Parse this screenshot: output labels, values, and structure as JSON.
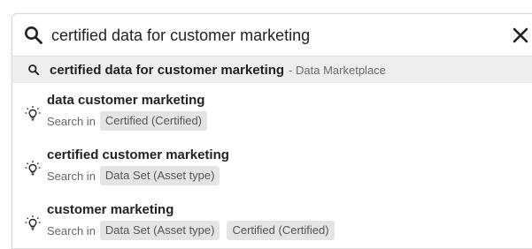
{
  "search": {
    "value": "certified data for customer marketing",
    "icon": "search-icon",
    "clear_icon": "close-icon"
  },
  "top_suggestion": {
    "icon": "search-icon",
    "query": "certified data for customer marketing",
    "source": "- Data Marketplace"
  },
  "results": [
    {
      "icon": "lightbulb-icon",
      "title": "data customer marketing",
      "search_in": "Search in",
      "tags": [
        "Certified (Certified)"
      ]
    },
    {
      "icon": "lightbulb-icon",
      "title": "certified customer marketing",
      "search_in": "Search in",
      "tags": [
        "Data Set (Asset type)"
      ]
    },
    {
      "icon": "lightbulb-icon",
      "title": "customer marketing",
      "search_in": "Search in",
      "tags": [
        "Data Set (Asset type)",
        "Certified (Certified)"
      ]
    }
  ],
  "colors": {
    "text": "#222222",
    "muted": "#666666",
    "tag_bg": "#e4e4e4",
    "highlight_bg": "#eeeeee"
  }
}
